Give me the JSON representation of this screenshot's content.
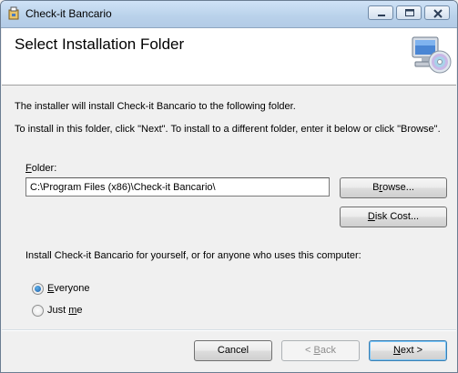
{
  "window": {
    "title": "Check-it Bancario",
    "app_icon": "installer-package-icon",
    "controls": {
      "minimize_icon": "minimize-icon",
      "maximize_icon": "maximize-icon",
      "close_icon": "close-icon"
    }
  },
  "header": {
    "title": "Select Installation Folder",
    "logo_icon": "computer-cd-icon"
  },
  "body": {
    "intro": "The installer will install Check-it Bancario to the following folder.",
    "instruction": "To install in this folder, click \"Next\". To install to a different folder, enter it below or click \"Browse\".",
    "folder_label_prefix": "F",
    "folder_label_rest": "older:",
    "folder_value": "C:\\Program Files (x86)\\Check-it Bancario\\",
    "browse_prefix": "B",
    "browse_underlined": "r",
    "browse_rest": "owse...",
    "disk_cost_prefix": "",
    "disk_cost_underlined": "D",
    "disk_cost_rest": "isk Cost...",
    "scope_question": "Install Check-it Bancario for yourself, or for anyone who uses this computer:",
    "option_everyone_underlined": "E",
    "option_everyone_rest": "veryone",
    "option_everyone_selected": true,
    "option_justme_prefix": "Just ",
    "option_justme_underlined": "m",
    "option_justme_rest": "e",
    "option_justme_selected": false
  },
  "footer": {
    "cancel_label": "Cancel",
    "back_arrow": "< ",
    "back_underlined": "B",
    "back_rest": "ack",
    "next_underlined": "N",
    "next_rest": "ext >"
  },
  "colors": {
    "accent": "#3c7fb1",
    "radio_selected": "#1a5ca8"
  }
}
